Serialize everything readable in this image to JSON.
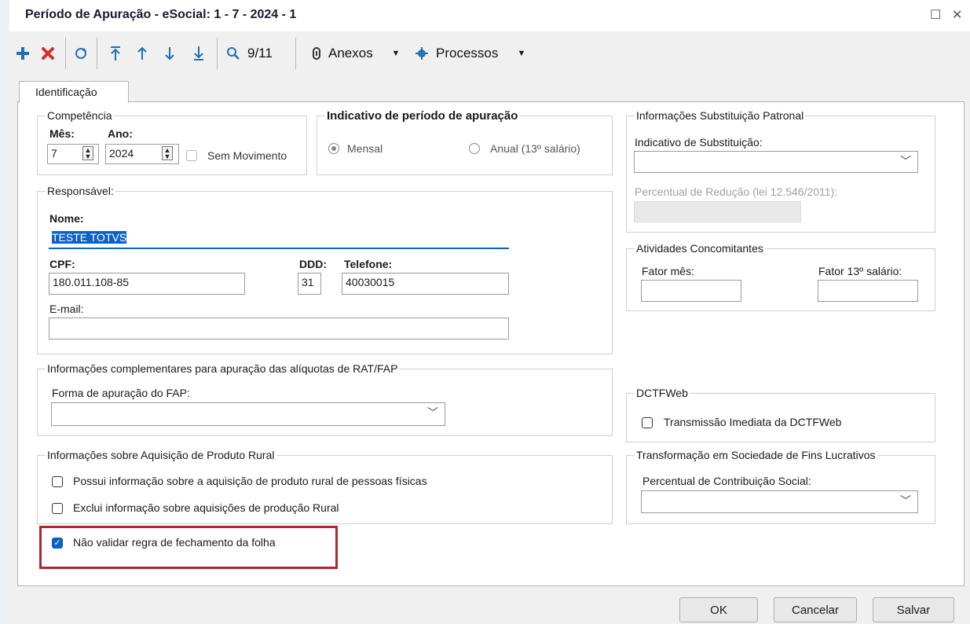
{
  "window": {
    "title": "Período de Apuração - eSocial: 1 - 7 - 2024 - 1",
    "maximize_glyph": "☐",
    "close_glyph": "✕"
  },
  "toolbar": {
    "counter": "9/11",
    "anexos_label": "Anexos",
    "processos_label": "Processos"
  },
  "tabs": [
    "Identificação"
  ],
  "competencia": {
    "legend": "Competência",
    "mes_label": "Mês:",
    "mes_value": "7",
    "ano_label": "Ano:",
    "ano_value": "2024",
    "sem_movimento_label": "Sem Movimento"
  },
  "indicativo": {
    "legend": "Indicativo de período de apuração",
    "mensal_label": "Mensal",
    "anual_label": "Anual (13º salário)"
  },
  "responsavel": {
    "legend": "Responsável:",
    "nome_label": "Nome:",
    "nome_value": "TESTE TOTVS",
    "cpf_label": "CPF:",
    "cpf_value": "180.011.108-85",
    "ddd_label": "DDD:",
    "ddd_value": "31",
    "telefone_label": "Telefone:",
    "telefone_value": "40030015",
    "email_label": "E-mail:",
    "email_value": ""
  },
  "substituicao": {
    "legend": "Informações Substituição Patronal",
    "indicativo_label": "Indicativo de Substituição:",
    "percentual_label": "Percentual de Redução  (lei 12.546/2011):"
  },
  "atividades": {
    "legend": "Atividades Concomitantes",
    "fator_mes_label": "Fator mês:",
    "fator_13_label": "Fator 13º salário:"
  },
  "rat_fap": {
    "legend": "Informações complementares para apuração das alíquotas de RAT/FAP",
    "forma_label": "Forma de apuração do FAP:"
  },
  "dctfweb": {
    "legend": "DCTFWeb",
    "transmissao_label": "Transmissão Imediata da DCTFWeb"
  },
  "produto_rural": {
    "legend": "Informações sobre Aquisição de Produto Rural",
    "possui_label": "Possui informação sobre a aquisição de produto rural de pessoas físicas",
    "exclui_label": "Exclui informação sobre aquisições de produção Rural"
  },
  "transformacao": {
    "legend": "Transformação em Sociedade de Fins Lucrativos",
    "percentual_label": "Percentual de Contribuição Social:"
  },
  "nao_validar_label": "Não validar regra de fechamento da folha",
  "buttons": {
    "ok": "OK",
    "cancelar": "Cancelar",
    "salvar": "Salvar"
  },
  "colors": {
    "accent": "#0b62c4",
    "highlight_border": "#b3262b",
    "add_icon": "#1f6fb5",
    "delete_icon": "#d32f2f"
  }
}
